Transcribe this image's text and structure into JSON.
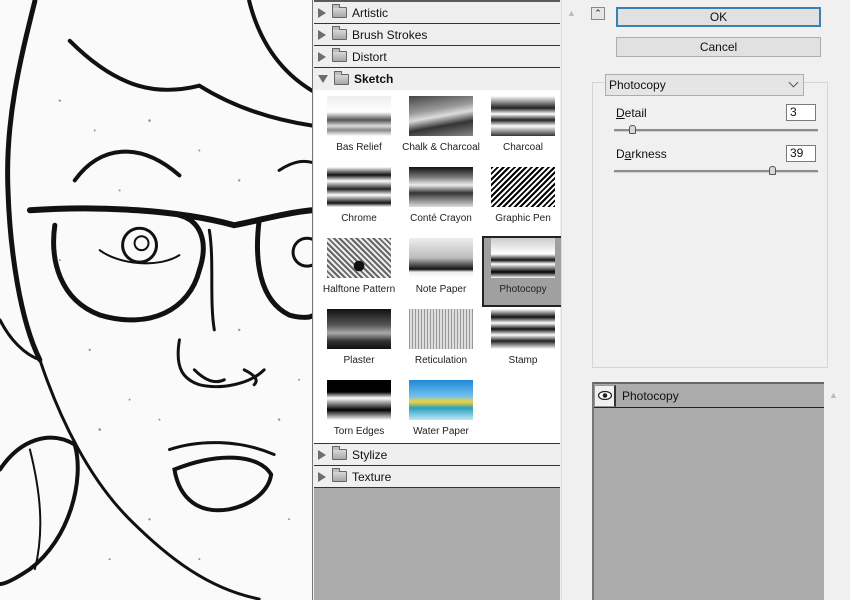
{
  "gallery": {
    "categories_top": [
      {
        "label": "Artistic",
        "expanded": false
      },
      {
        "label": "Brush Strokes",
        "expanded": false
      },
      {
        "label": "Distort",
        "expanded": false
      },
      {
        "label": "Sketch",
        "expanded": true
      }
    ],
    "sketch_filters": [
      {
        "label": "Bas Relief"
      },
      {
        "label": "Chalk & Charcoal"
      },
      {
        "label": "Charcoal"
      },
      {
        "label": "Chrome"
      },
      {
        "label": "Conté Crayon"
      },
      {
        "label": "Graphic Pen"
      },
      {
        "label": "Halftone Pattern"
      },
      {
        "label": "Note Paper"
      },
      {
        "label": "Photocopy",
        "selected": true
      },
      {
        "label": "Plaster"
      },
      {
        "label": "Reticulation"
      },
      {
        "label": "Stamp"
      },
      {
        "label": "Torn Edges"
      },
      {
        "label": "Water Paper"
      }
    ],
    "categories_bottom": [
      {
        "label": "Stylize",
        "expanded": false
      },
      {
        "label": "Texture",
        "expanded": false
      }
    ]
  },
  "buttons": {
    "ok": "OK",
    "cancel": "Cancel"
  },
  "filter_select": {
    "value": "Photocopy"
  },
  "params": {
    "detail": {
      "label_pre": "",
      "label_ul": "D",
      "label_post": "etail",
      "value": "3",
      "min": 1,
      "max": 24
    },
    "darkness": {
      "label_pre": "D",
      "label_ul": "a",
      "label_post": "rkness",
      "value": "39",
      "min": 1,
      "max": 50
    }
  },
  "layers": [
    {
      "name": "Photocopy",
      "visible": true
    }
  ],
  "icons": {
    "collapse": "double-chevron-up-icon",
    "eye": "eye-icon",
    "folder": "folder-icon"
  }
}
